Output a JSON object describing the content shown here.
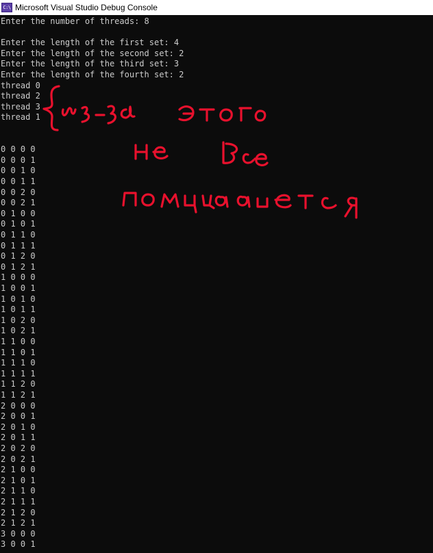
{
  "window": {
    "title": "Microsoft Visual Studio Debug Console",
    "icon": "console-app-icon",
    "icon_glyph": "C:\\"
  },
  "console": {
    "text_color": "#cccccc",
    "background": "#0c0c0c",
    "lines": [
      "Enter the number of threads: 8",
      "",
      "Enter the length of the first set: 4",
      "Enter the length of the second set: 2",
      "Enter the length of the third set: 3",
      "Enter the length of the fourth set: 2",
      "thread 0",
      "thread 2",
      "thread 3",
      "thread 1",
      "",
      "",
      "0 0 0 0",
      "0 0 0 1",
      "0 0 1 0",
      "0 0 1 1",
      "0 0 2 0",
      "0 0 2 1",
      "0 1 0 0",
      "0 1 0 1",
      "0 1 1 0",
      "0 1 1 1",
      "0 1 2 0",
      "0 1 2 1",
      "1 0 0 0",
      "1 0 0 1",
      "1 0 1 0",
      "1 0 1 1",
      "1 0 2 0",
      "1 0 2 1",
      "1 1 0 0",
      "1 1 0 1",
      "1 1 1 0",
      "1 1 1 1",
      "1 1 2 0",
      "1 1 2 1",
      "2 0 0 0",
      "2 0 0 1",
      "2 0 1 0",
      "2 0 1 1",
      "2 0 2 0",
      "2 0 2 1",
      "2 1 0 0",
      "2 1 0 1",
      "2 1 1 0",
      "2 1 1 1",
      "2 1 2 0",
      "2 1 2 1",
      "3 0 0 0",
      "3 0 0 1"
    ]
  },
  "annotation": {
    "color": "#e8112d",
    "kind": "handwritten-ink",
    "lines": [
      "из-за этого",
      "не все",
      "помещается"
    ]
  }
}
